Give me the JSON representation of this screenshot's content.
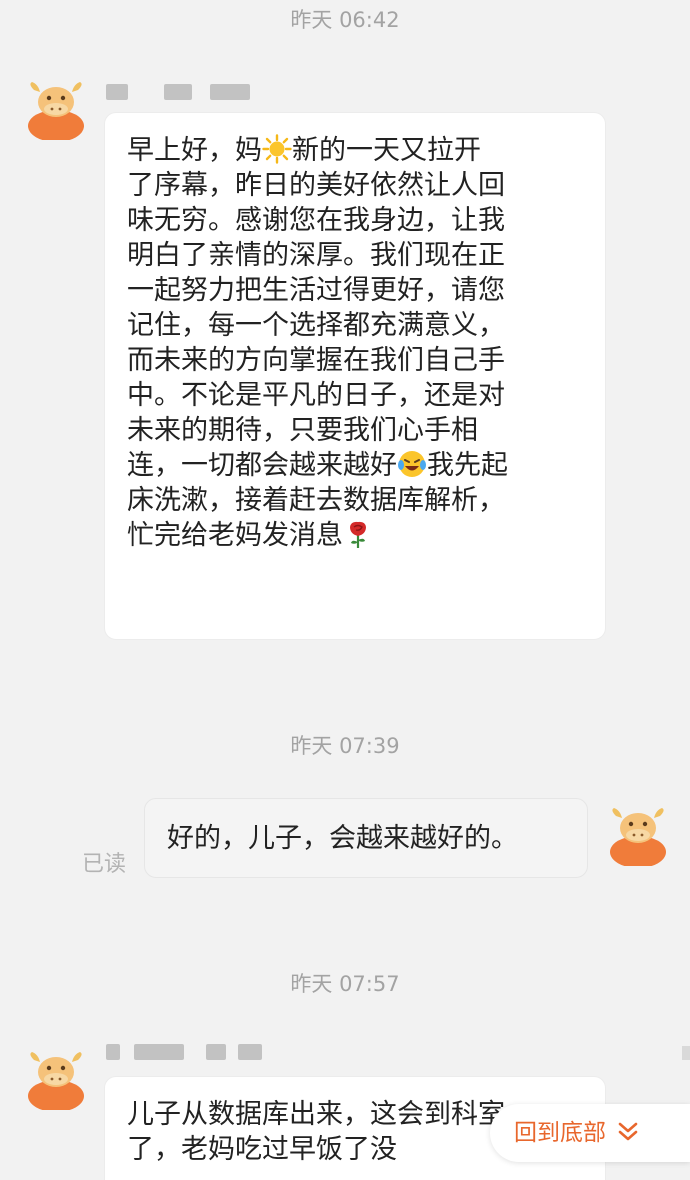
{
  "timestamps": [
    "昨天 06:42",
    "昨天 07:39",
    "昨天 07:57"
  ],
  "messages": [
    {
      "lines": [
        "早上好，妈",
        "新的一天又拉开",
        "了序幕，昨日的美好依然让人回",
        "味无穷。感谢您在我身边，让我",
        "明白了亲情的深厚。我们现在正",
        "一起努力把生活过得更好，请您",
        "记住，每一个选择都充满意义，",
        "而未来的方向掌握在我们自己手",
        "中。不论是平凡的日子，还是对",
        "未来的期待，只要我们心手相",
        "连，一切都会越来越好",
        "我先起",
        "床洗漱，接着赶去数据库解析，",
        "忙完给老妈发消息"
      ],
      "emojis": [
        "sun-emoji",
        "laughing-crying-emoji",
        "rose-emoji"
      ]
    },
    {
      "text": "好的，儿子，会越来越好的。",
      "status": "已读"
    },
    {
      "lines": [
        "儿子从数据库出来，这会到科室",
        "了，老妈吃过早饭了没"
      ]
    }
  ],
  "scroll_button": {
    "label": "回到底部",
    "icon": "double-chevron-down-icon"
  },
  "colors": {
    "background": "#f2f2f2",
    "bubble": "#ffffff",
    "accent": "#e8672d",
    "timestamp": "#a3a3a3"
  }
}
